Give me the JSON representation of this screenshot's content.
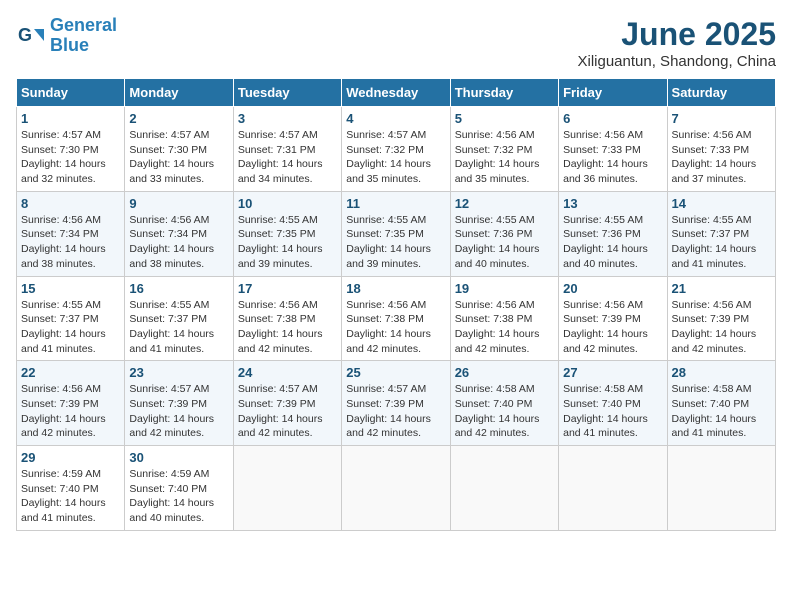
{
  "header": {
    "logo_line1": "General",
    "logo_line2": "Blue",
    "title": "June 2025",
    "subtitle": "Xiliguantun, Shandong, China"
  },
  "days_of_week": [
    "Sunday",
    "Monday",
    "Tuesday",
    "Wednesday",
    "Thursday",
    "Friday",
    "Saturday"
  ],
  "weeks": [
    [
      {
        "num": "1",
        "sunrise": "4:57 AM",
        "sunset": "7:30 PM",
        "daylight": "14 hours and 32 minutes."
      },
      {
        "num": "2",
        "sunrise": "4:57 AM",
        "sunset": "7:30 PM",
        "daylight": "14 hours and 33 minutes."
      },
      {
        "num": "3",
        "sunrise": "4:57 AM",
        "sunset": "7:31 PM",
        "daylight": "14 hours and 34 minutes."
      },
      {
        "num": "4",
        "sunrise": "4:57 AM",
        "sunset": "7:32 PM",
        "daylight": "14 hours and 35 minutes."
      },
      {
        "num": "5",
        "sunrise": "4:56 AM",
        "sunset": "7:32 PM",
        "daylight": "14 hours and 35 minutes."
      },
      {
        "num": "6",
        "sunrise": "4:56 AM",
        "sunset": "7:33 PM",
        "daylight": "14 hours and 36 minutes."
      },
      {
        "num": "7",
        "sunrise": "4:56 AM",
        "sunset": "7:33 PM",
        "daylight": "14 hours and 37 minutes."
      }
    ],
    [
      {
        "num": "8",
        "sunrise": "4:56 AM",
        "sunset": "7:34 PM",
        "daylight": "14 hours and 38 minutes."
      },
      {
        "num": "9",
        "sunrise": "4:56 AM",
        "sunset": "7:34 PM",
        "daylight": "14 hours and 38 minutes."
      },
      {
        "num": "10",
        "sunrise": "4:55 AM",
        "sunset": "7:35 PM",
        "daylight": "14 hours and 39 minutes."
      },
      {
        "num": "11",
        "sunrise": "4:55 AM",
        "sunset": "7:35 PM",
        "daylight": "14 hours and 39 minutes."
      },
      {
        "num": "12",
        "sunrise": "4:55 AM",
        "sunset": "7:36 PM",
        "daylight": "14 hours and 40 minutes."
      },
      {
        "num": "13",
        "sunrise": "4:55 AM",
        "sunset": "7:36 PM",
        "daylight": "14 hours and 40 minutes."
      },
      {
        "num": "14",
        "sunrise": "4:55 AM",
        "sunset": "7:37 PM",
        "daylight": "14 hours and 41 minutes."
      }
    ],
    [
      {
        "num": "15",
        "sunrise": "4:55 AM",
        "sunset": "7:37 PM",
        "daylight": "14 hours and 41 minutes."
      },
      {
        "num": "16",
        "sunrise": "4:55 AM",
        "sunset": "7:37 PM",
        "daylight": "14 hours and 41 minutes."
      },
      {
        "num": "17",
        "sunrise": "4:56 AM",
        "sunset": "7:38 PM",
        "daylight": "14 hours and 42 minutes."
      },
      {
        "num": "18",
        "sunrise": "4:56 AM",
        "sunset": "7:38 PM",
        "daylight": "14 hours and 42 minutes."
      },
      {
        "num": "19",
        "sunrise": "4:56 AM",
        "sunset": "7:38 PM",
        "daylight": "14 hours and 42 minutes."
      },
      {
        "num": "20",
        "sunrise": "4:56 AM",
        "sunset": "7:39 PM",
        "daylight": "14 hours and 42 minutes."
      },
      {
        "num": "21",
        "sunrise": "4:56 AM",
        "sunset": "7:39 PM",
        "daylight": "14 hours and 42 minutes."
      }
    ],
    [
      {
        "num": "22",
        "sunrise": "4:56 AM",
        "sunset": "7:39 PM",
        "daylight": "14 hours and 42 minutes."
      },
      {
        "num": "23",
        "sunrise": "4:57 AM",
        "sunset": "7:39 PM",
        "daylight": "14 hours and 42 minutes."
      },
      {
        "num": "24",
        "sunrise": "4:57 AM",
        "sunset": "7:39 PM",
        "daylight": "14 hours and 42 minutes."
      },
      {
        "num": "25",
        "sunrise": "4:57 AM",
        "sunset": "7:39 PM",
        "daylight": "14 hours and 42 minutes."
      },
      {
        "num": "26",
        "sunrise": "4:58 AM",
        "sunset": "7:40 PM",
        "daylight": "14 hours and 42 minutes."
      },
      {
        "num": "27",
        "sunrise": "4:58 AM",
        "sunset": "7:40 PM",
        "daylight": "14 hours and 41 minutes."
      },
      {
        "num": "28",
        "sunrise": "4:58 AM",
        "sunset": "7:40 PM",
        "daylight": "14 hours and 41 minutes."
      }
    ],
    [
      {
        "num": "29",
        "sunrise": "4:59 AM",
        "sunset": "7:40 PM",
        "daylight": "14 hours and 41 minutes."
      },
      {
        "num": "30",
        "sunrise": "4:59 AM",
        "sunset": "7:40 PM",
        "daylight": "14 hours and 40 minutes."
      },
      null,
      null,
      null,
      null,
      null
    ]
  ]
}
